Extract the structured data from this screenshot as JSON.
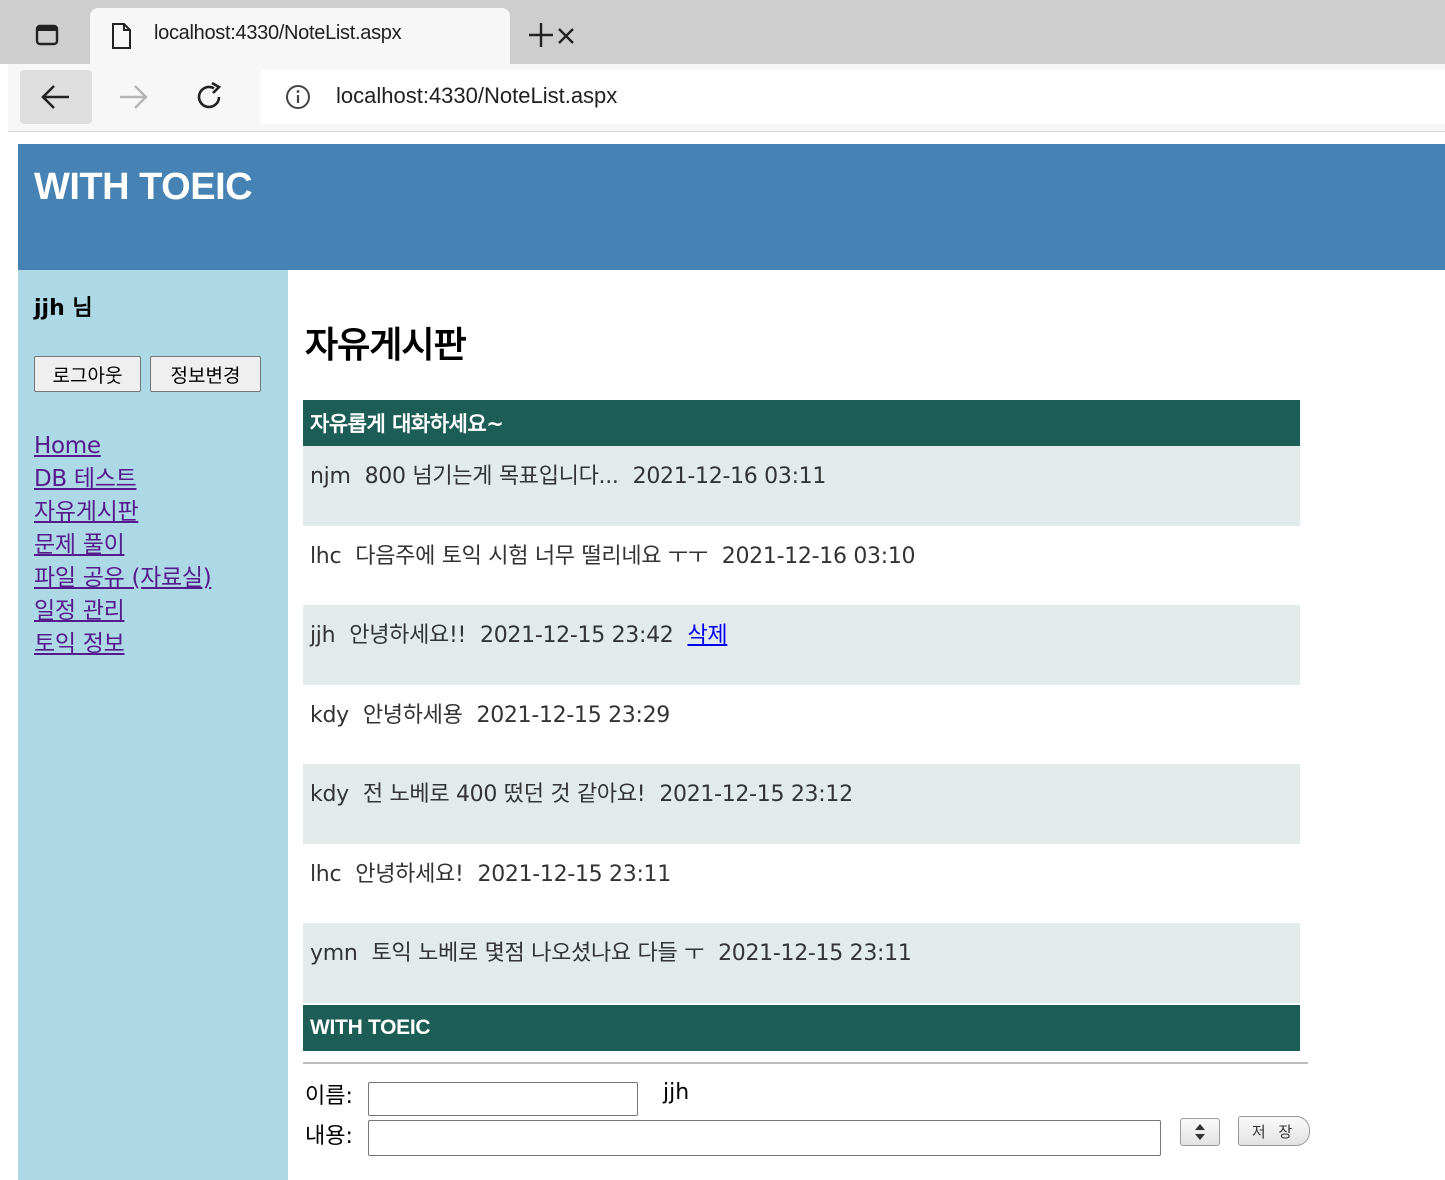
{
  "browser": {
    "tab_title": "localhost:4330/NoteList.aspx",
    "url": "localhost:4330/NoteList.aspx"
  },
  "site": {
    "brand": "WITH TOEIC"
  },
  "sidebar": {
    "user_label": "jjh 님",
    "logout_label": "로그아웃",
    "edit_label": "정보변경",
    "nav": [
      "Home",
      "DB 테스트",
      "자유게시판",
      "문제 풀이",
      "파일 공유 (자료실)",
      "일정 관리",
      "토익 정보"
    ]
  },
  "board": {
    "title": "자유게시판",
    "header": "자유롭게 대화하세요~",
    "footer": "WITH TOEIC",
    "delete_label": "삭제",
    "posts": [
      {
        "author": "njm",
        "message": "800 넘기는게 목표입니다...",
        "date": "2021-12-16 03:11"
      },
      {
        "author": "lhc",
        "message": "다음주에 토익 시험 너무 떨리네요 ㅜㅜ",
        "date": "2021-12-16 03:10"
      },
      {
        "author": "jjh",
        "message": "안녕하세요!!",
        "date": "2021-12-15 23:42"
      },
      {
        "author": "kdy",
        "message": "안녕하세용",
        "date": "2021-12-15 23:29"
      },
      {
        "author": "kdy",
        "message": "전 노베로 400 떴던 것 같아요!",
        "date": "2021-12-15 23:12"
      },
      {
        "author": "lhc",
        "message": "안녕하세요!",
        "date": "2021-12-15 23:11"
      },
      {
        "author": "ymn",
        "message": "토익 노베로 몇점 나오셨나요 다들 ㅜ",
        "date": "2021-12-15 23:11"
      }
    ]
  },
  "form": {
    "name_label": "이름:",
    "name_value": "jjh",
    "content_label": "내용:",
    "save_label": "저 장"
  }
}
